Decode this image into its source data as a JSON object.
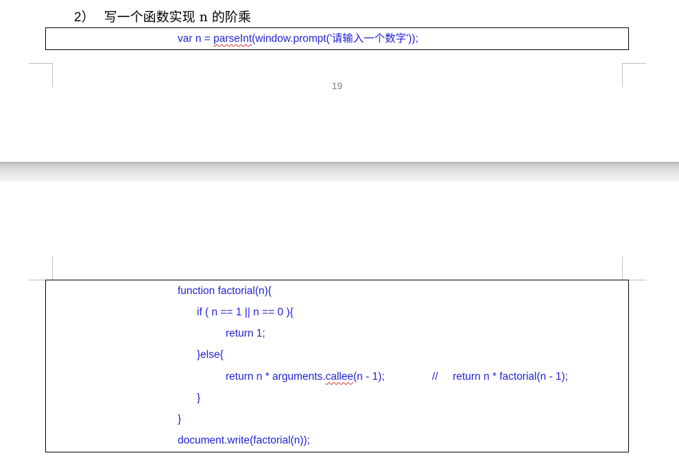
{
  "section_heading": {
    "number": "2）",
    "text": "写一个函数实现 n 的阶乘"
  },
  "code_top": {
    "line1_a": "var n = ",
    "line1_b": "parseInt",
    "line1_c": "(window.prompt('请输入一个数字'));"
  },
  "page_number": "19",
  "code_bottom": {
    "line1": "function factorial(n){",
    "line2": "if ( n == 1 || n == 0 ){",
    "line3": "return 1;",
    "line4": "}else{",
    "line5_a": "return n * arguments.",
    "line5_b": "callee",
    "line5_c": "(n - 1);",
    "line5_comment": "//     return n * factorial(n - 1);",
    "line6": "}",
    "line7": "}",
    "line8": "document.write(factorial(n));"
  }
}
